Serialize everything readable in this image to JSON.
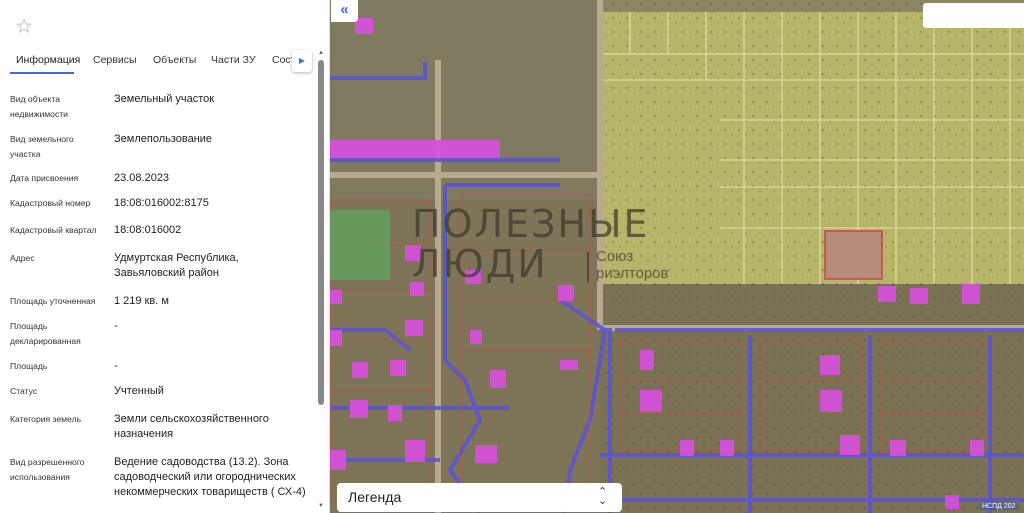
{
  "panel": {
    "star_icon": "star-outline-icon",
    "tabs": [
      {
        "label": "Информация",
        "active": true
      },
      {
        "label": "Сервисы",
        "active": false
      },
      {
        "label": "Объекты",
        "active": false
      },
      {
        "label": "Части ЗУ",
        "active": false
      },
      {
        "label": "Сост",
        "active": false
      }
    ],
    "tab_scroll_icon": "chevron-right-icon",
    "rows": [
      {
        "label": "Вид объекта недвижимости",
        "value": "Земельный участок"
      },
      {
        "label": "Вид земельного участка",
        "value": "Землепользование"
      },
      {
        "label": "Дата присвоения",
        "value": "23.08.2023"
      },
      {
        "label": "Кадастровый номер",
        "value": "18:08:016002:8175"
      },
      {
        "label": "Кадастровый квартал",
        "value": "18:08:016002"
      },
      {
        "label": "Адрес",
        "value": "Удмуртская Республика, Завьяловский район"
      },
      {
        "label": "Площадь уточненная",
        "value": "1 219 кв. м"
      },
      {
        "label": "Площадь декларированная",
        "value": "-"
      },
      {
        "label": "Площадь",
        "value": "-"
      },
      {
        "label": "Статус",
        "value": "Учтенный"
      },
      {
        "label": "Категория земель",
        "value": "Земли сельскохозяйственного назначения"
      },
      {
        "label": "Вид разрешенного использования",
        "value": "Ведение садоводства (13.2). Зона садоводческий или огороднических некоммерческих товариществ ( СХ-4)"
      }
    ]
  },
  "map": {
    "collapse_label": "«",
    "legend_label": "Легенда",
    "watermark_line1": "ПОЛЕЗНЫЕ",
    "watermark_line2": "ЛЮДИ",
    "watermark_brand1": "Союз",
    "watermark_brand2": "риэлторов",
    "attribution": "НСПД 202",
    "colors": {
      "parcel_highlight": "#c9d54a",
      "building": "#d94fe0",
      "road": "#5a52d6",
      "boundary": "#d33a3a",
      "selected_zone": "#3fb05a"
    }
  }
}
